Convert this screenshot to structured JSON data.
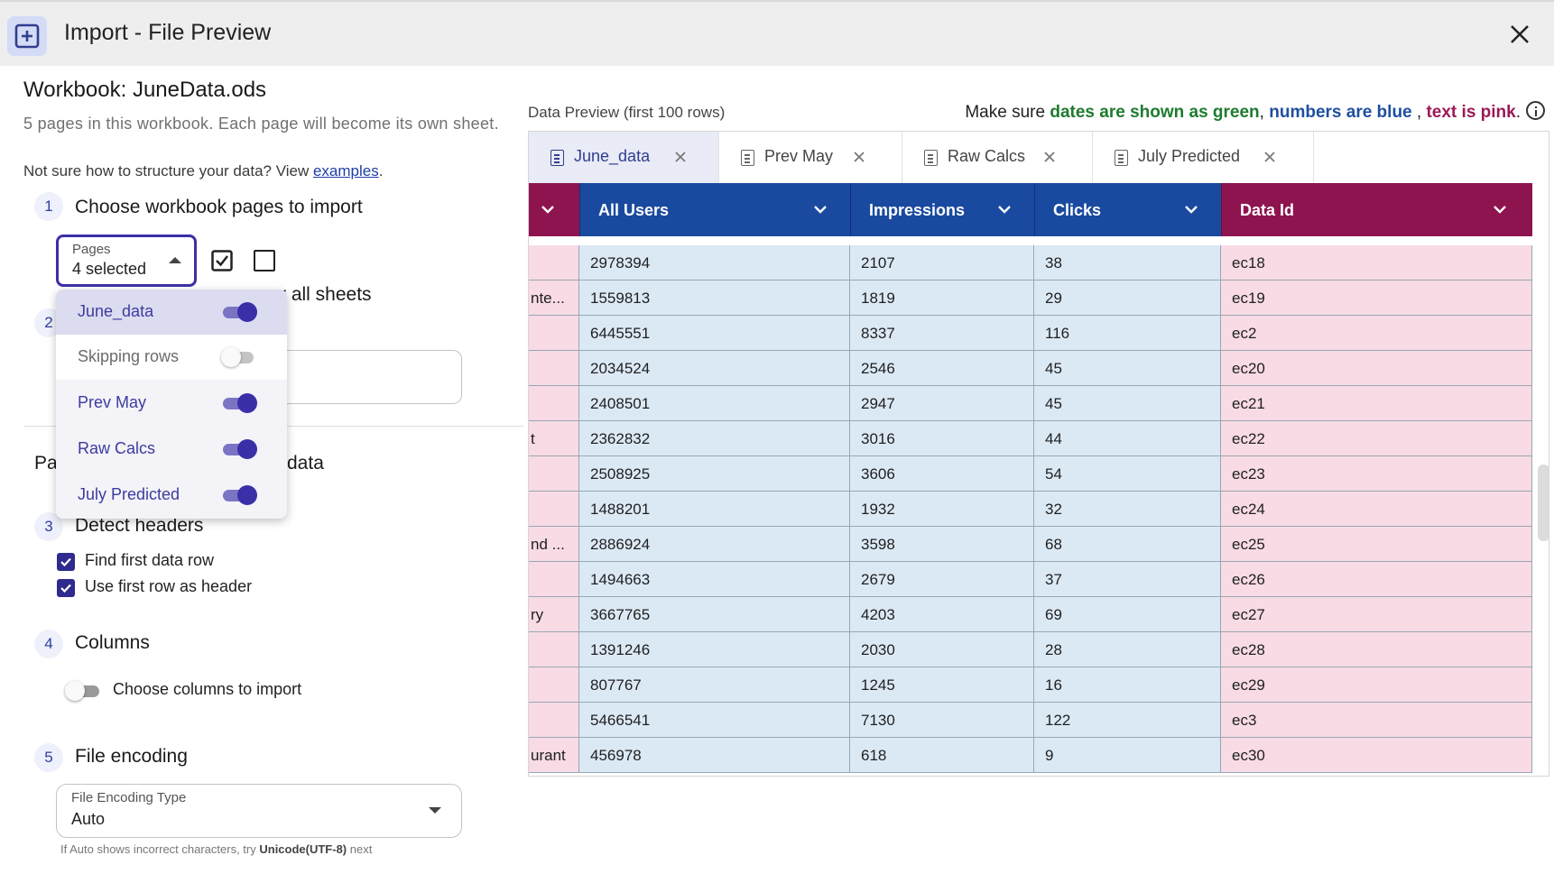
{
  "window": {
    "title": "Import - File Preview"
  },
  "workbook": {
    "title": "Workbook: JuneData.ods",
    "subtitle": "5 pages in this workbook. Each page will become its own sheet.",
    "help_prefix": "Not sure how to structure your data? View ",
    "help_link": "examples",
    "help_suffix": "."
  },
  "steps": {
    "s1": {
      "num": "1",
      "label": "Choose workbook pages to import"
    },
    "s2": {
      "num": "2",
      "label_visible_part": "r all sheets"
    },
    "parse": {
      "label_left": "Pa",
      "label_right": "data"
    },
    "s3": {
      "num": "3",
      "label": "Detect headers"
    },
    "s4": {
      "num": "4",
      "label": "Columns"
    },
    "s5": {
      "num": "5",
      "label": "File encoding"
    }
  },
  "pages_select": {
    "label": "Pages",
    "value": "4 selected",
    "options": [
      {
        "name": "June_data",
        "on": true
      },
      {
        "name": "Skipping rows",
        "on": false
      },
      {
        "name": "Prev May",
        "on": true
      },
      {
        "name": "Raw Calcs",
        "on": true
      },
      {
        "name": "July Predicted",
        "on": true
      }
    ]
  },
  "detect_headers": {
    "find_first_row": {
      "label": "Find first data row",
      "checked": true
    },
    "use_first_row": {
      "label": "Use first row as header",
      "checked": true
    }
  },
  "columns": {
    "toggle_label": "Choose columns to import",
    "on": false
  },
  "encoding": {
    "label": "File Encoding Type",
    "value": "Auto",
    "hint_prefix": "If Auto shows incorrect characters, try ",
    "hint_bold": "Unicode(UTF-8)",
    "hint_suffix": " next"
  },
  "preview": {
    "label": "Data Preview (first 100 rows)",
    "legend": {
      "prefix": "Make sure ",
      "dates": "dates are shown as green",
      "sep1": ", ",
      "numbers": "numbers are blue",
      "sep2": " , ",
      "text": "text is pink",
      "suffix": "."
    },
    "colors": {
      "date": "#1e7b2e",
      "number": "#1a4aa0",
      "text": "#8e1450"
    },
    "tabs": [
      "June_data",
      "Prev May",
      "Raw Calcs",
      "July Predicted"
    ],
    "active_tab": "June_data",
    "columns": [
      {
        "name": "",
        "type": "text"
      },
      {
        "name": "All Users",
        "type": "number"
      },
      {
        "name": "Impressions",
        "type": "number"
      },
      {
        "name": "Clicks",
        "type": "number"
      },
      {
        "name": "Data Id",
        "type": "text"
      }
    ],
    "rows": [
      [
        "",
        "2978394",
        "2107",
        "38",
        "ec18"
      ],
      [
        "nte...",
        "1559813",
        "1819",
        "29",
        "ec19"
      ],
      [
        "",
        "6445551",
        "8337",
        "116",
        "ec2"
      ],
      [
        "",
        "2034524",
        "2546",
        "45",
        "ec20"
      ],
      [
        "",
        "2408501",
        "2947",
        "45",
        "ec21"
      ],
      [
        "t",
        "2362832",
        "3016",
        "44",
        "ec22"
      ],
      [
        "",
        "2508925",
        "3606",
        "54",
        "ec23"
      ],
      [
        "",
        "1488201",
        "1932",
        "32",
        "ec24"
      ],
      [
        "nd ...",
        "2886924",
        "3598",
        "68",
        "ec25"
      ],
      [
        "",
        "1494663",
        "2679",
        "37",
        "ec26"
      ],
      [
        "ry",
        "3667765",
        "4203",
        "69",
        "ec27"
      ],
      [
        "",
        "1391246",
        "2030",
        "28",
        "ec28"
      ],
      [
        "",
        "807767",
        "1245",
        "16",
        "ec29"
      ],
      [
        "",
        "5466541",
        "7130",
        "122",
        "ec3"
      ],
      [
        "urant",
        "456978",
        "618",
        "9",
        "ec30"
      ]
    ]
  }
}
